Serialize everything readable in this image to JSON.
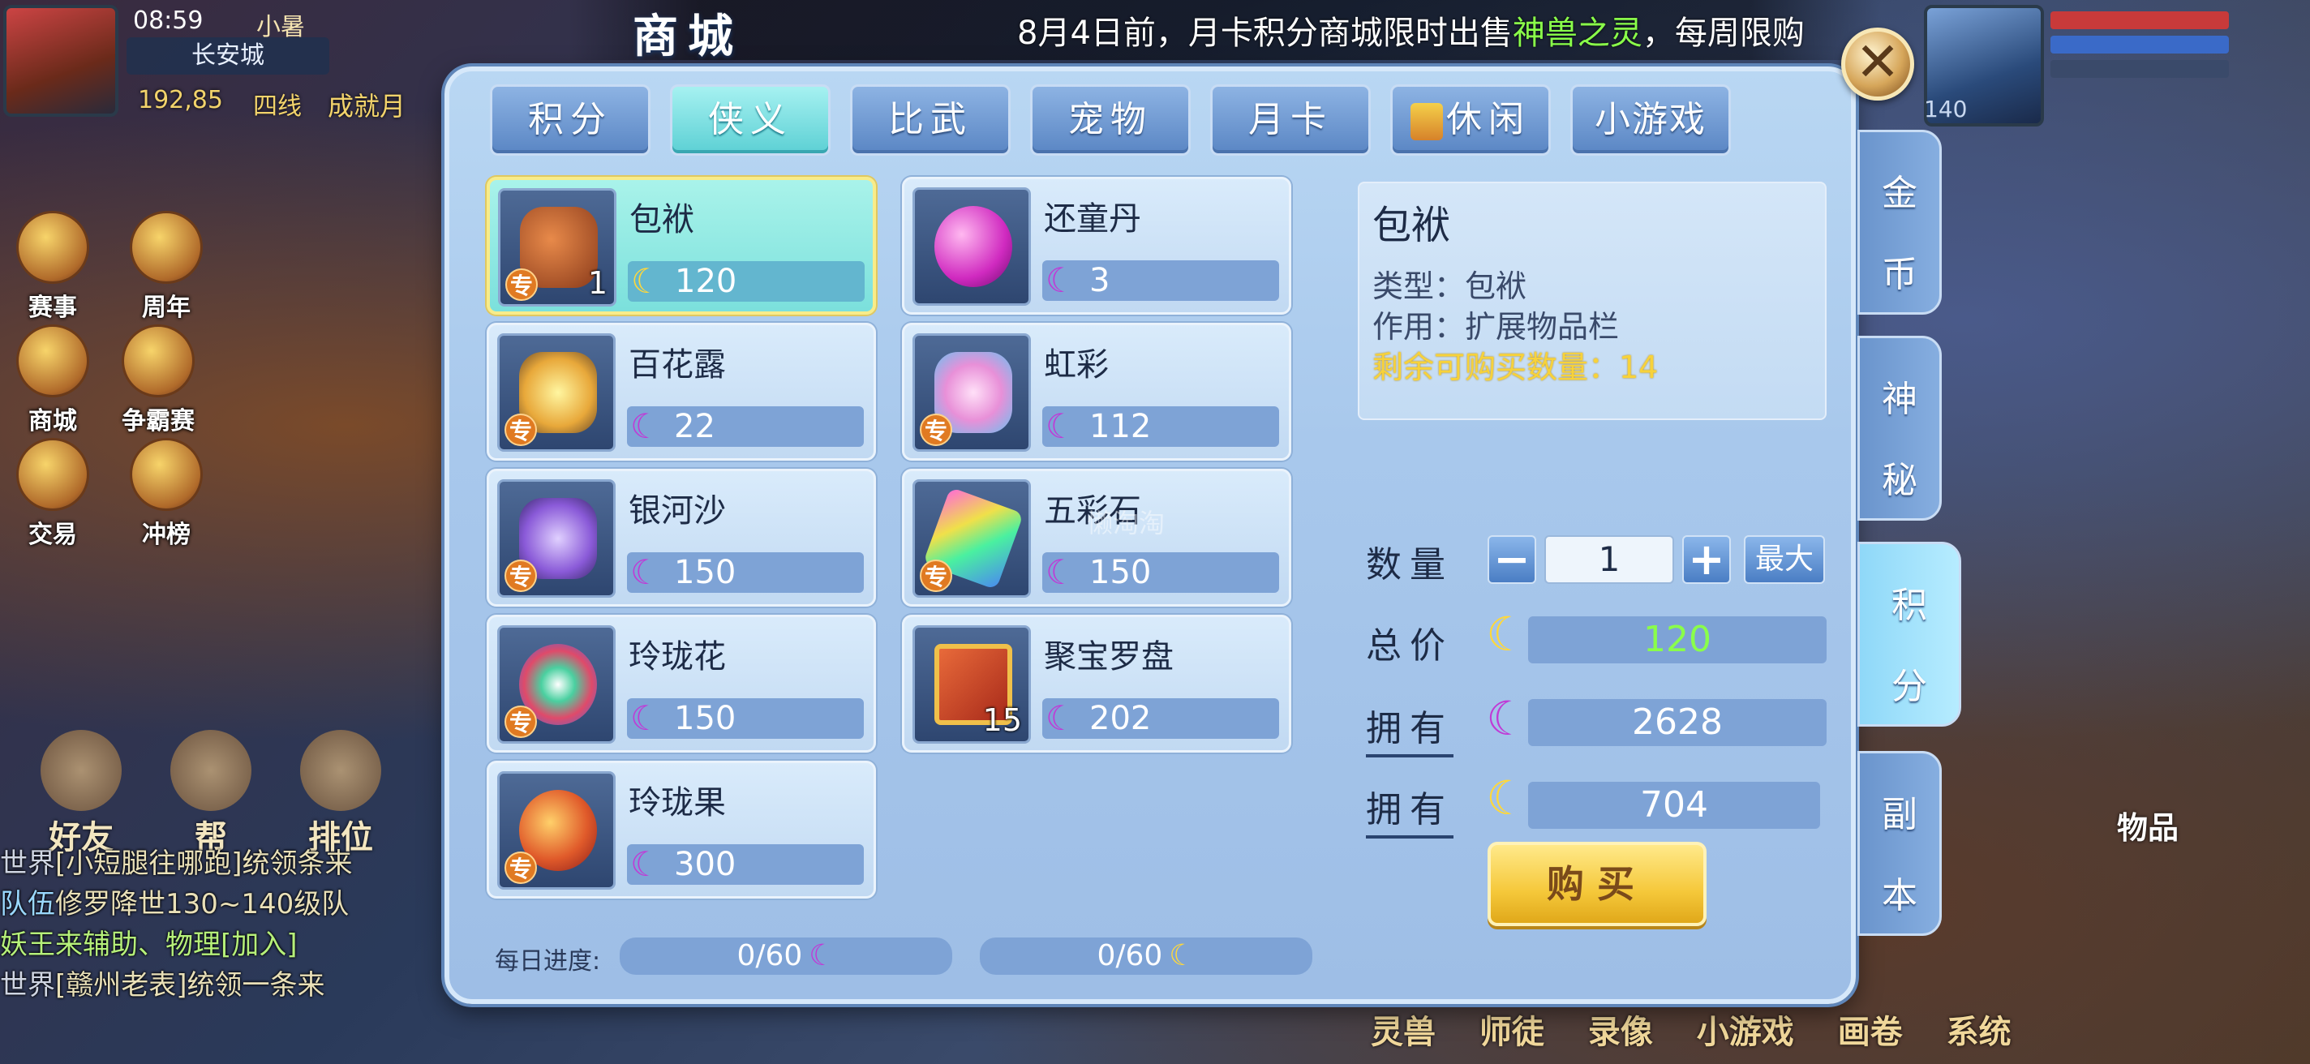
{
  "status": {
    "time": "08:59",
    "player": "小暑",
    "location": "长安城",
    "coords": "192,85",
    "line": "四线",
    "achievement": "成就月"
  },
  "hud_left": [
    {
      "label": "赛事"
    },
    {
      "label": "周年"
    },
    {
      "label": "商城"
    },
    {
      "label": "争霸赛"
    },
    {
      "label": "交易"
    },
    {
      "label": "冲榜"
    }
  ],
  "bottom_buttons": [
    {
      "label": "好友"
    },
    {
      "label": "帮"
    },
    {
      "label": "排位"
    }
  ],
  "chat": [
    {
      "channel": "世界",
      "text": "[小短腿往哪跑]统领条来"
    },
    {
      "channel": "队伍",
      "text": "修罗降世130~140级队"
    },
    {
      "channel": "",
      "text": "妖王来辅助、物理[加入]"
    },
    {
      "channel": "世界",
      "text": "[赣州老表]统领一条来"
    }
  ],
  "hud_right": {
    "level": "140",
    "items_label": "物品",
    "bottom_menu": "灵兽 师徒 录像 小游戏 画卷 系统"
  },
  "shop": {
    "title": "商城",
    "notice_prefix": "8月4日前，月卡积分商城限时出售",
    "notice_highlight": "神兽之灵",
    "notice_suffix": "，每周限购",
    "close_label": "✕",
    "tabs": [
      {
        "label": "积分"
      },
      {
        "label": "侠义"
      },
      {
        "label": "比武"
      },
      {
        "label": "宠物"
      },
      {
        "label": "月卡"
      },
      {
        "label": "休闲"
      },
      {
        "label": "小游戏"
      }
    ],
    "side_tabs": [
      {
        "label1": "金",
        "label2": "币"
      },
      {
        "label1": "神",
        "label2": "秘"
      },
      {
        "label1": "积",
        "label2": "分"
      },
      {
        "label1": "副",
        "label2": "本"
      }
    ],
    "items": [
      {
        "name": "包袱",
        "price": "120",
        "qty": "1",
        "badge": "专",
        "currency": "gold",
        "color": "#c86a3a"
      },
      {
        "name": "还童丹",
        "price": "3",
        "qty": "",
        "badge": "",
        "currency": "purple",
        "color": "#e03ad6"
      },
      {
        "name": "百花露",
        "price": "22",
        "qty": "",
        "badge": "专",
        "currency": "purple",
        "color": "#e8c04a"
      },
      {
        "name": "虹彩",
        "price": "112",
        "qty": "",
        "badge": "专",
        "currency": "purple",
        "color": "#e6a0d8"
      },
      {
        "name": "银河沙",
        "price": "150",
        "qty": "",
        "badge": "专",
        "currency": "purple",
        "color": "#8a6ae0"
      },
      {
        "name": "五彩石",
        "price": "150",
        "qty": "",
        "badge": "专",
        "currency": "purple",
        "color": "#6ad8f0"
      },
      {
        "name": "玲珑花",
        "price": "150",
        "qty": "",
        "badge": "专",
        "currency": "purple",
        "color": "#4ad0a0"
      },
      {
        "name": "聚宝罗盘",
        "price": "202",
        "qty": "15",
        "badge": "",
        "currency": "purple",
        "color": "#c84a2a"
      },
      {
        "name": "玲珑果",
        "price": "300",
        "qty": "",
        "badge": "专",
        "currency": "purple",
        "color": "#e05a3a"
      }
    ],
    "detail": {
      "name": "包袱",
      "type_line": "类型：包袱",
      "use_line": "作用：扩展物品栏",
      "remaining_line": "剩余可购买数量：14"
    },
    "purchase": {
      "qty_label": "数量",
      "qty_value": "1",
      "minus_label": "−",
      "plus_label": "+",
      "max_label": "最大",
      "total_label": "总价",
      "total_value": "120",
      "own_label": "拥有",
      "own_purple": "2628",
      "own_gold": "704",
      "buy_label": "购买"
    },
    "progress": {
      "label": "每日进度:",
      "purple": "0/60",
      "gold": "0/60"
    },
    "watermark": "懒淘淘"
  },
  "colors": {
    "moon_purple": "#c03ad6",
    "moon_gold": "#ffd83a",
    "active_tab": "#5cd0d4",
    "buy": "#f5c83a"
  }
}
